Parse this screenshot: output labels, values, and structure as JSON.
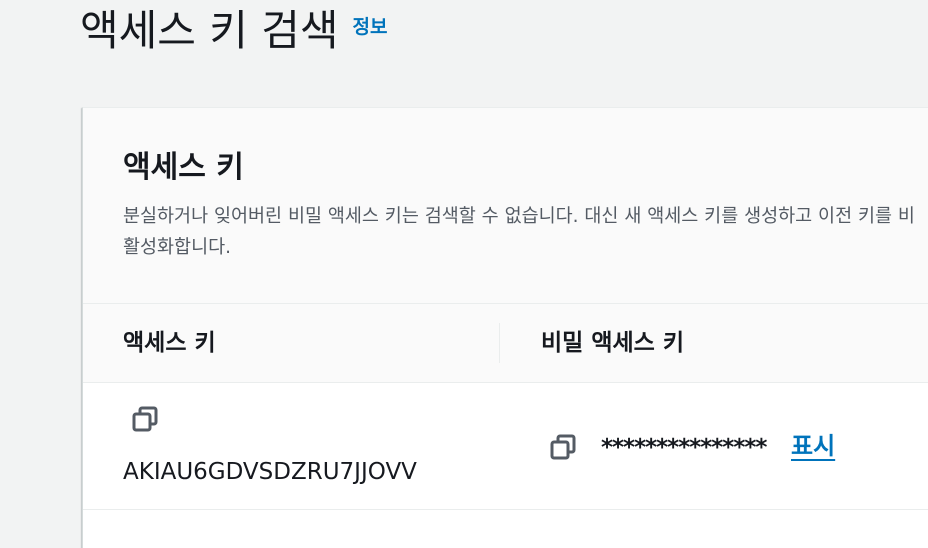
{
  "header": {
    "title": "액세스 키 검색",
    "info_link": "정보"
  },
  "panel": {
    "title": "액세스 키",
    "description": "분실하거나 잊어버린 비밀 액세스 키는 검색할 수 없습니다. 대신 새 액세스 키를 생성하고 이전 키를 비활성화합니다."
  },
  "table": {
    "columns": [
      "액세스 키",
      "비밀 액세스 키"
    ],
    "row": {
      "access_key": "AKIAU6GDVSDZRU7JJOVV",
      "secret_key_masked": "***************",
      "show_label": "표시"
    }
  },
  "colors": {
    "link": "#0073bb",
    "text": "#16191f",
    "secondary_text": "#545b64",
    "page_background": "#f2f3f3"
  },
  "icons": [
    "copy-icon",
    "copy-icon"
  ]
}
